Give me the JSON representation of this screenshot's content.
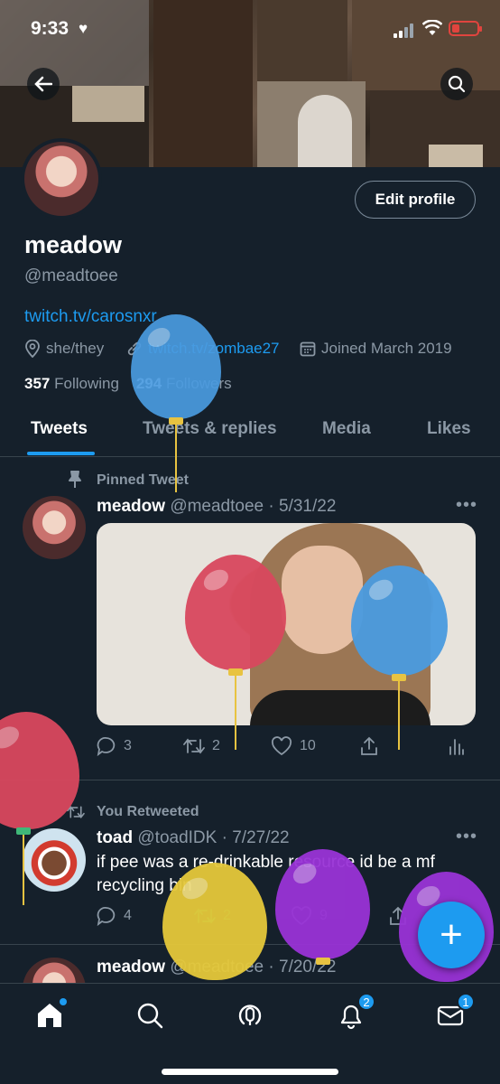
{
  "status_bar": {
    "time": "9:33"
  },
  "profile": {
    "name": "meadow",
    "handle": "@meadtoee",
    "edit_button": "Edit profile",
    "bio_link": "twitch.tv/carosnxr",
    "pronouns": "she/they",
    "website": "twitch.tv/zombae27",
    "joined": "Joined March 2019",
    "following_count": "357",
    "following_label": "Following",
    "followers_count": "294",
    "followers_label": "Followers"
  },
  "tabs": [
    {
      "label": "Tweets",
      "active": true
    },
    {
      "label": "Tweets & replies",
      "active": false
    },
    {
      "label": "Media",
      "active": false
    },
    {
      "label": "Likes",
      "active": false
    }
  ],
  "tweets": [
    {
      "context": "Pinned Tweet",
      "name": "meadow",
      "handle": "@meadtoee",
      "date": "· 5/31/22",
      "replies": "3",
      "retweets": "2",
      "likes": "10"
    },
    {
      "context": "You Retweeted",
      "name": "toad",
      "handle": "@toadIDK",
      "date": "· 7/27/22",
      "text": "if pee was a re-drinkable resource id be a mf recycling bin",
      "replies": "4",
      "retweets": "2",
      "likes": "9"
    },
    {
      "name": "meadow",
      "handle": "@meadtoee",
      "date": "· 7/20/22"
    }
  ],
  "nav": {
    "notifications_badge": "2",
    "messages_badge": "1"
  },
  "colors": {
    "background": "#15202b",
    "accent": "#1d9bf0",
    "muted": "#8b98a5",
    "divider": "#38444d"
  }
}
